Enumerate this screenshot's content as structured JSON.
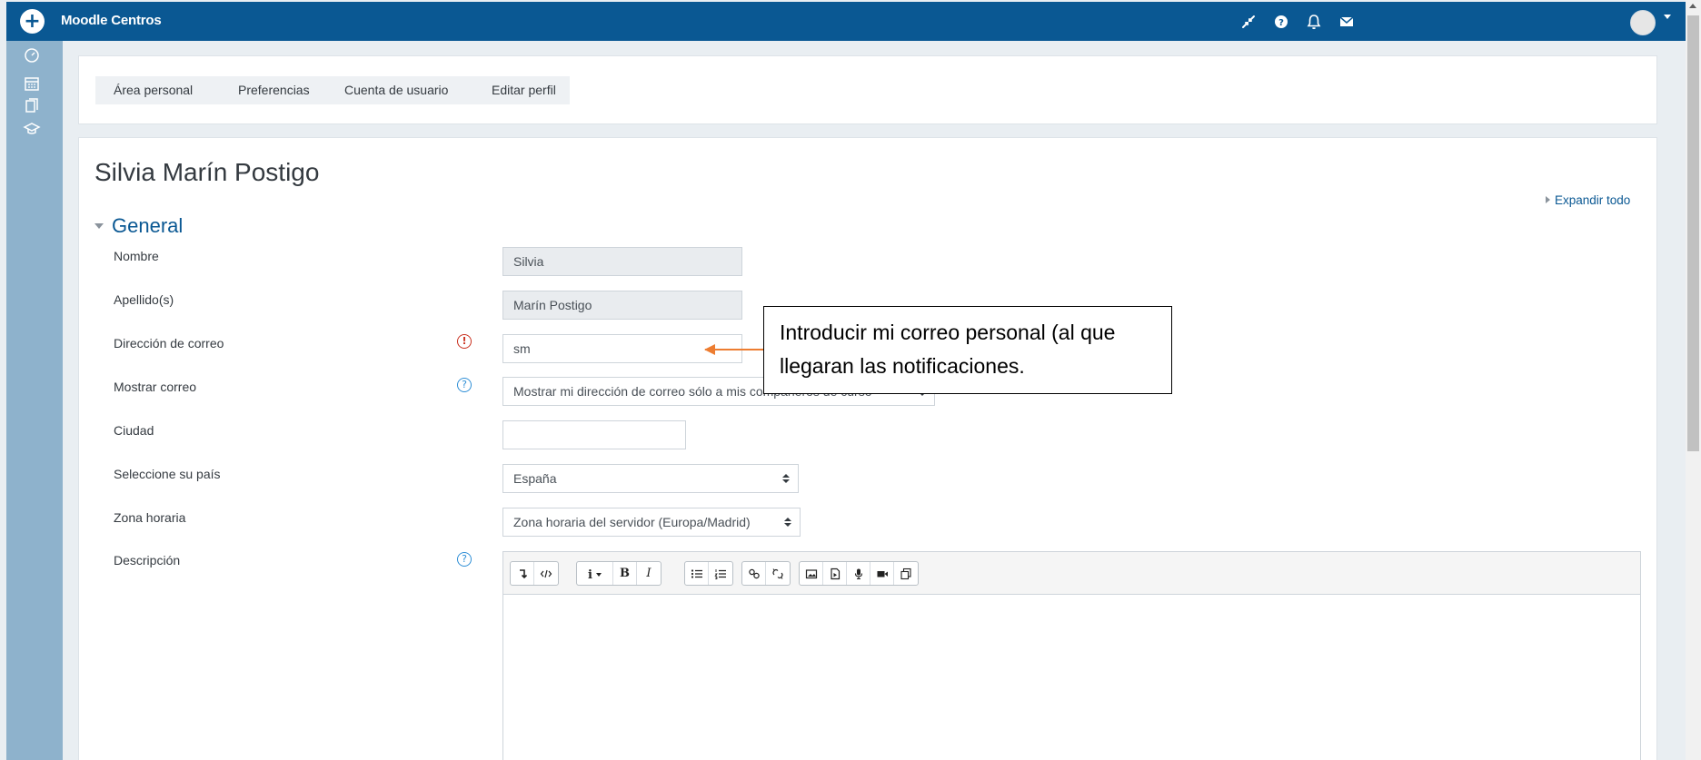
{
  "app": {
    "name": "Moodle Centros"
  },
  "navbar": {
    "icons": [
      "collapse-icon",
      "help-icon",
      "bell-icon",
      "envelope-icon",
      "avatar"
    ]
  },
  "drawer": {
    "icons": [
      "dashboard-icon",
      "calendar-icon",
      "files-icon",
      "graduation-cap-icon"
    ]
  },
  "breadcrumb": {
    "items": [
      "Área personal",
      "Preferencias",
      "Cuenta de usuario",
      "Editar perfil"
    ]
  },
  "page": {
    "title": "Silvia Marín Postigo",
    "expand_all": "Expandir todo"
  },
  "section": {
    "title": "General"
  },
  "form": {
    "nombre": {
      "label": "Nombre",
      "value": "Silvia"
    },
    "apellidos": {
      "label": "Apellido(s)",
      "value": "Marín Postigo"
    },
    "correo": {
      "label": "Dirección de correo",
      "value": "sm"
    },
    "mostrar_correo": {
      "label": "Mostrar correo",
      "value": "Mostrar mi dirección de correo sólo a mis compañeros de curso"
    },
    "ciudad": {
      "label": "Ciudad",
      "value": ""
    },
    "pais": {
      "label": "Seleccione su país",
      "value": "España"
    },
    "zona_horaria": {
      "label": "Zona horaria",
      "value": "Zona horaria del servidor (Europa/Madrid)"
    },
    "descripcion": {
      "label": "Descripción"
    }
  },
  "editor": {
    "toolbar_groups": [
      [
        "insert-line-icon",
        "html-icon"
      ],
      [
        "info-dropdown-icon",
        "bold-icon",
        "italic-icon"
      ],
      [
        "bullet-list-icon",
        "numbered-list-icon"
      ],
      [
        "link-icon",
        "unlink-icon"
      ],
      [
        "image-icon",
        "media-icon",
        "microphone-icon",
        "video-icon",
        "copy-icon"
      ]
    ]
  },
  "annotation": {
    "text": "Introducir mi correo personal (al que llegaran las notificaciones.",
    "arrow_color": "#ed7d31"
  },
  "colors": {
    "navbar": "#0a5893",
    "drawer": "#8eb2cc",
    "link": "#0a5893",
    "required": "#ca3120",
    "help": "#2f8fd6"
  }
}
